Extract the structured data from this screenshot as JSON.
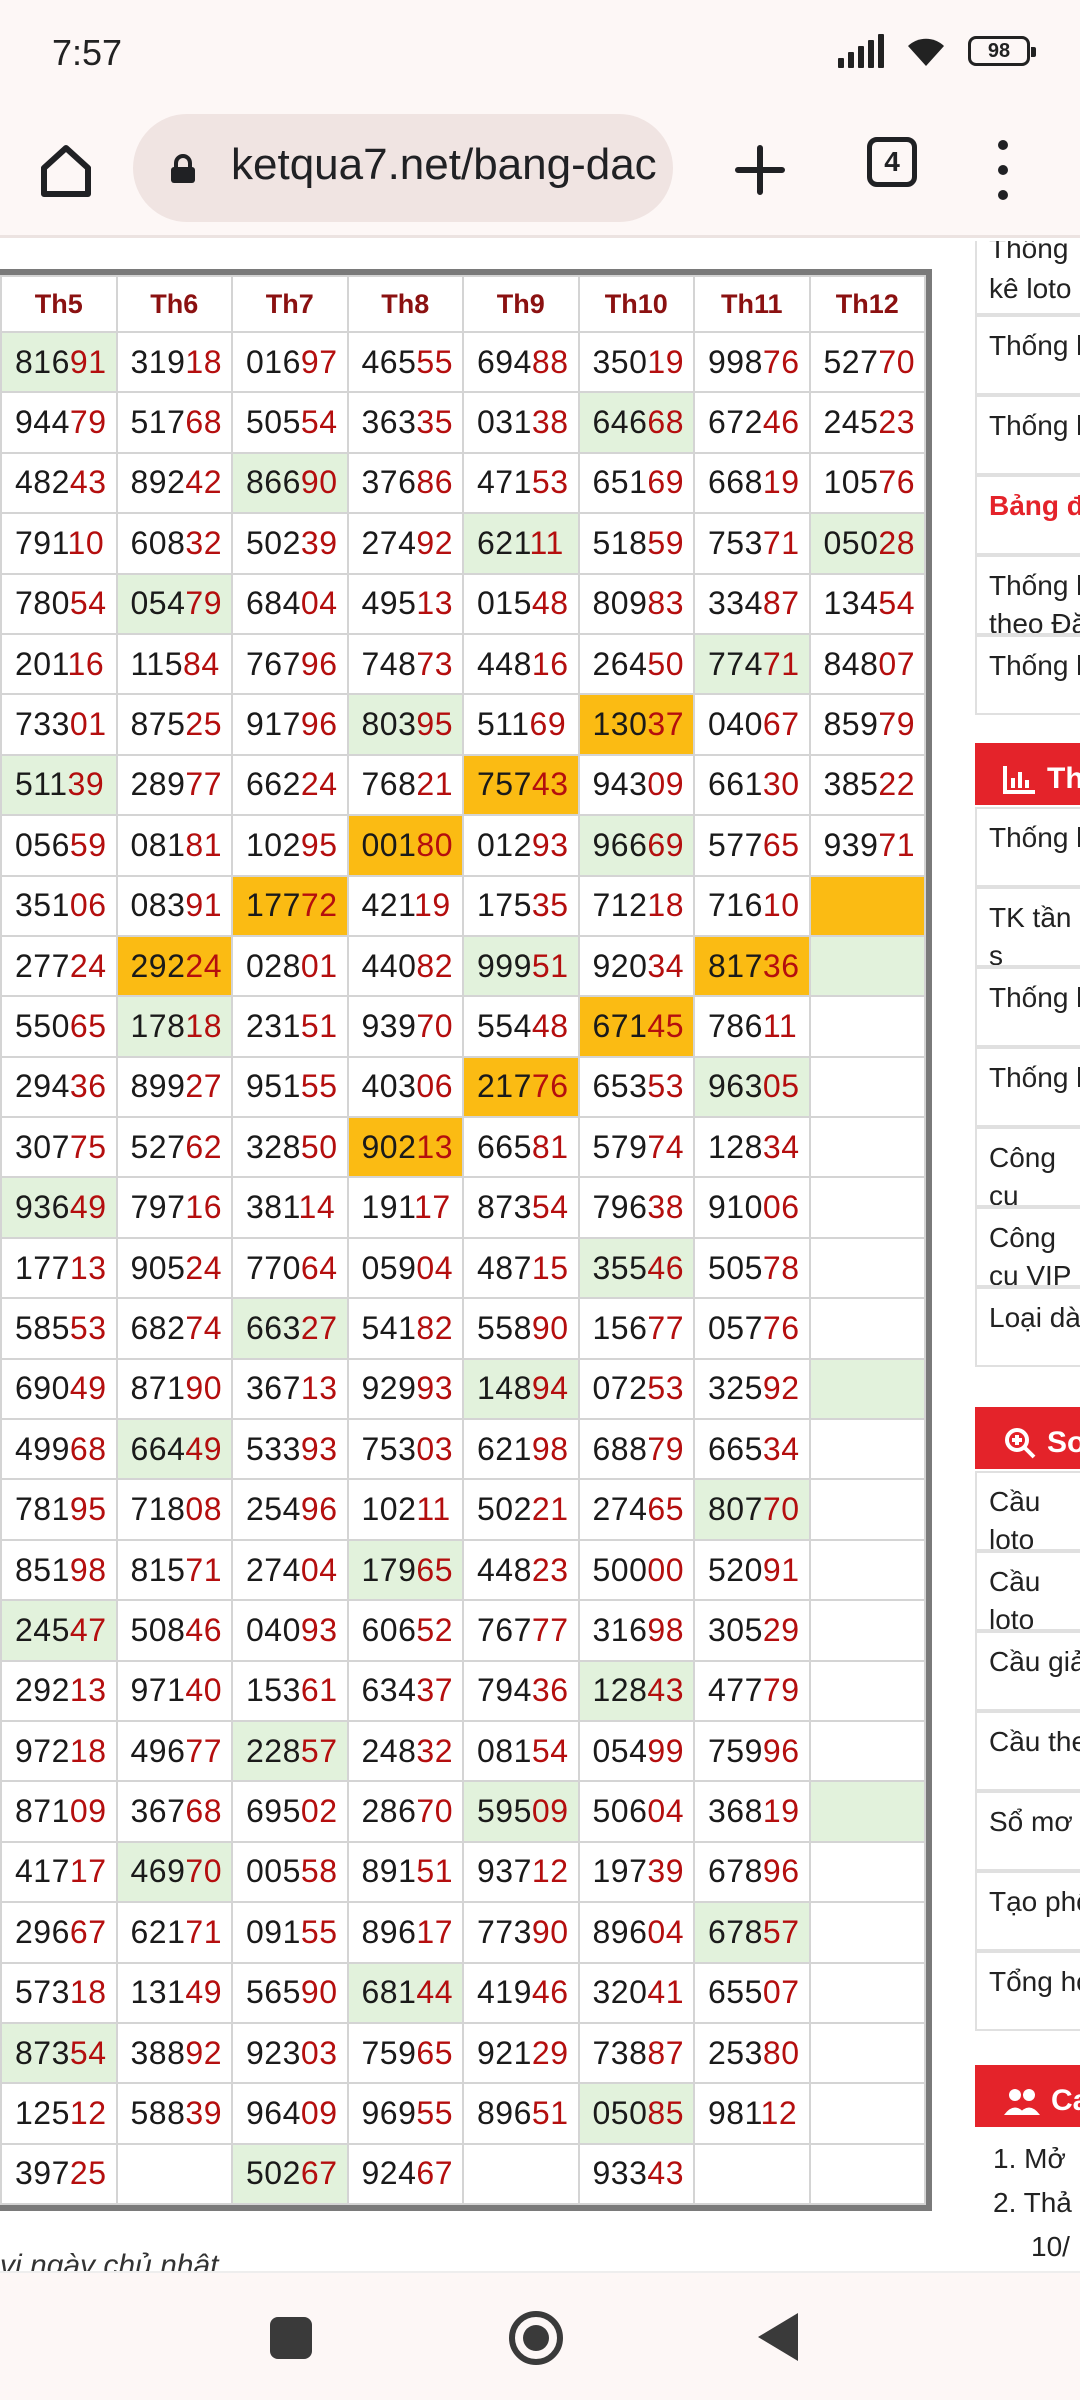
{
  "status": {
    "time": "7:57",
    "battery": "98",
    "icons": [
      "signal-icon",
      "wifi-icon",
      "battery-icon"
    ]
  },
  "browser": {
    "url": "ketqua7.net/bang-dac",
    "tab_count": "4",
    "icons": [
      "home-icon",
      "lock-icon",
      "plus-icon",
      "tabs-icon",
      "more-vert-icon"
    ]
  },
  "table": {
    "headers": [
      "Th5",
      "Th6",
      "Th7",
      "Th8",
      "Th9",
      "Th10",
      "Th11",
      "Th12"
    ],
    "rows": [
      [
        "81691",
        "31918",
        "01697",
        "46555",
        "69488",
        "35019",
        "99876",
        "52770"
      ],
      [
        "94479",
        "51768",
        "50554",
        "36335",
        "03138",
        "64668",
        "67246",
        "24523"
      ],
      [
        "48243",
        "89242",
        "86690",
        "37686",
        "47153",
        "65169",
        "66819",
        "10576"
      ],
      [
        "79110",
        "60832",
        "50239",
        "27492",
        "62111",
        "51859",
        "75371",
        "05028"
      ],
      [
        "78054",
        "05479",
        "68404",
        "49513",
        "01548",
        "80983",
        "33487",
        "13454"
      ],
      [
        "20116",
        "11584",
        "76796",
        "74873",
        "44816",
        "26450",
        "77471",
        "84807"
      ],
      [
        "73301",
        "87525",
        "91796",
        "80395",
        "51169",
        "13037",
        "04067",
        "85979"
      ],
      [
        "51139",
        "28977",
        "66224",
        "76821",
        "75743",
        "94309",
        "66130",
        "38522"
      ],
      [
        "05659",
        "08181",
        "10295",
        "00180",
        "01293",
        "96669",
        "57765",
        "93971"
      ],
      [
        "35106",
        "08391",
        "17772",
        "42119",
        "17535",
        "71218",
        "71610",
        ""
      ],
      [
        "27724",
        "29224",
        "02801",
        "44082",
        "99951",
        "92034",
        "81736",
        ""
      ],
      [
        "55065",
        "17818",
        "23151",
        "93970",
        "55448",
        "67145",
        "78611",
        ""
      ],
      [
        "29436",
        "89927",
        "95155",
        "40306",
        "21776",
        "65353",
        "96305",
        ""
      ],
      [
        "30775",
        "52762",
        "32850",
        "90213",
        "66581",
        "57974",
        "12834",
        ""
      ],
      [
        "93649",
        "79716",
        "38114",
        "19117",
        "87354",
        "79638",
        "91006",
        ""
      ],
      [
        "17713",
        "90524",
        "77064",
        "05904",
        "48715",
        "35546",
        "50578",
        ""
      ],
      [
        "58553",
        "68274",
        "66327",
        "54182",
        "55890",
        "15677",
        "05776",
        ""
      ],
      [
        "69049",
        "87190",
        "36713",
        "92993",
        "14894",
        "07253",
        "32592",
        ""
      ],
      [
        "49968",
        "66449",
        "53393",
        "75303",
        "62198",
        "68879",
        "66534",
        ""
      ],
      [
        "78195",
        "71808",
        "25496",
        "10211",
        "50221",
        "27465",
        "80770",
        ""
      ],
      [
        "85198",
        "81571",
        "27404",
        "17965",
        "44823",
        "50000",
        "52091",
        ""
      ],
      [
        "24547",
        "50846",
        "04093",
        "60652",
        "76777",
        "31698",
        "30529",
        ""
      ],
      [
        "29213",
        "97140",
        "15361",
        "63437",
        "79436",
        "12843",
        "47779",
        ""
      ],
      [
        "97218",
        "49677",
        "22857",
        "24832",
        "08154",
        "05499",
        "75996",
        ""
      ],
      [
        "87109",
        "36768",
        "69502",
        "28670",
        "59509",
        "50604",
        "36819",
        ""
      ],
      [
        "41717",
        "46970",
        "00558",
        "89151",
        "93712",
        "19739",
        "67896",
        ""
      ],
      [
        "29667",
        "62171",
        "09155",
        "89617",
        "77390",
        "89604",
        "67857",
        ""
      ],
      [
        "57318",
        "13149",
        "56590",
        "68144",
        "41946",
        "32041",
        "65507",
        ""
      ],
      [
        "87354",
        "38892",
        "92303",
        "75965",
        "92129",
        "73887",
        "25380",
        ""
      ],
      [
        "12512",
        "58839",
        "96409",
        "96955",
        "89651",
        "05085",
        "98112",
        ""
      ],
      [
        "39725",
        "",
        "50267",
        "92467",
        "",
        "93343",
        "",
        ""
      ]
    ],
    "highlights": {
      "green": [
        [
          0,
          0
        ],
        [
          1,
          5
        ],
        [
          2,
          2
        ],
        [
          3,
          4
        ],
        [
          3,
          7
        ],
        [
          4,
          1
        ],
        [
          5,
          6
        ],
        [
          6,
          3
        ],
        [
          7,
          0
        ],
        [
          8,
          5
        ],
        [
          10,
          4
        ],
        [
          10,
          7
        ],
        [
          11,
          1
        ],
        [
          12,
          6
        ],
        [
          14,
          0
        ],
        [
          15,
          5
        ],
        [
          16,
          2
        ],
        [
          17,
          4
        ],
        [
          17,
          7
        ],
        [
          18,
          1
        ],
        [
          19,
          6
        ],
        [
          20,
          3
        ],
        [
          21,
          0
        ],
        [
          22,
          5
        ],
        [
          23,
          2
        ],
        [
          24,
          4
        ],
        [
          24,
          7
        ],
        [
          25,
          1
        ],
        [
          26,
          6
        ],
        [
          27,
          3
        ],
        [
          28,
          0
        ],
        [
          29,
          5
        ],
        [
          30,
          2
        ]
      ],
      "orange": [
        [
          6,
          5
        ],
        [
          7,
          4
        ],
        [
          8,
          3
        ],
        [
          9,
          2
        ],
        [
          9,
          7
        ],
        [
          10,
          1
        ],
        [
          10,
          6
        ],
        [
          11,
          5
        ],
        [
          12,
          4
        ],
        [
          13,
          3
        ]
      ]
    },
    "colors": {
      "green": "#e2f2dc",
      "orange": "#fbbb13",
      "header_text": "#8b1111",
      "tail_digits": "#b40e0e"
    }
  },
  "below_text": "vi ngày chủ nhật",
  "sidebar": {
    "top_item": "Thống kê loto",
    "items_1": [
      "Thống k",
      "Thống k",
      "Bảng đ",
      "Thống k theo Đặ",
      "Thống k"
    ],
    "section_1": "Th",
    "items_2": [
      "Thống k",
      "TK tần s",
      "Thống k",
      "Thống k",
      "Công cụ",
      "Công cụ VIP",
      "Loại dà"
    ],
    "section_2": "So",
    "items_3": [
      "Cầu loto",
      "Cầu loto",
      "Cầu giả",
      "Cầu the",
      "Sổ mơ",
      "Tạo phô",
      "Tổng họ"
    ],
    "section_3": "Ca",
    "list": [
      "1. Mở",
      "2. Thả",
      "10/"
    ]
  },
  "nav": {
    "icons": [
      "recents-icon",
      "home-icon",
      "back-icon"
    ]
  }
}
